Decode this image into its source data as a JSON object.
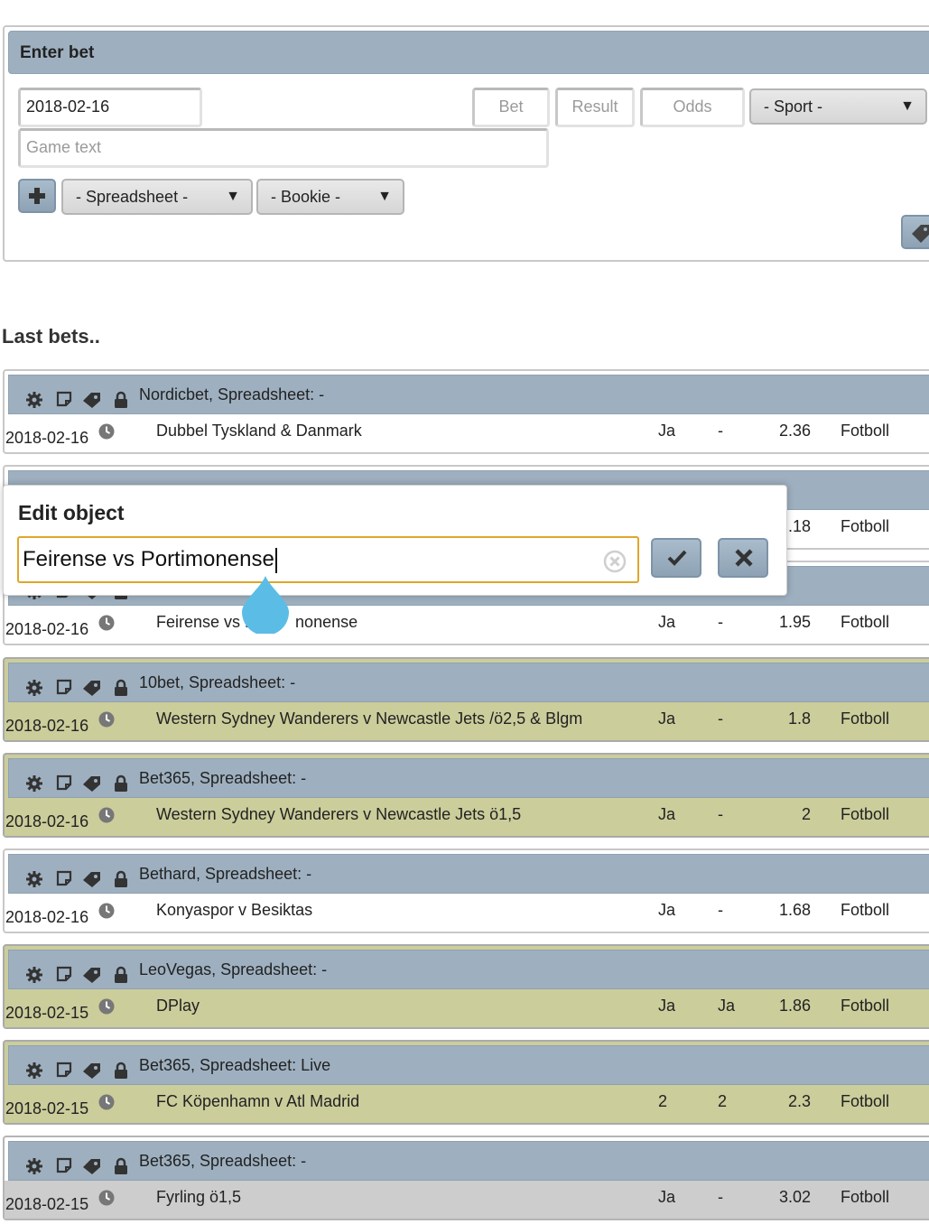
{
  "enter_bet": {
    "title": "Enter bet",
    "date_value": "2018-02-16",
    "bet_placeholder": "Bet",
    "result_placeholder": "Result",
    "odds_placeholder": "Odds",
    "sport_select": "- Sport -",
    "game_text_placeholder": "Game text",
    "add_icon": "plus-icon",
    "spreadsheet_select": "- Spreadsheet -",
    "bookie_select": "- Bookie -",
    "dropdown_arrow": "▼"
  },
  "last_bets_title": "Last bets..",
  "bets": [
    {
      "header": "Nordicbet, Spreadsheet: -",
      "date": "2018-02-16",
      "game": "Dubbel Tyskland & Danmark",
      "bet": "Ja",
      "result": "-",
      "odds": "2.36",
      "sport": "Fotboll",
      "style": "white"
    },
    {
      "header": "",
      "date": "",
      "game": "",
      "bet": "",
      "result": "",
      "odds": ".18",
      "sport": "Fotboll",
      "style": "white"
    },
    {
      "header": "",
      "date": "2018-02-16",
      "game": "Feirense vs P",
      "game_tail": "nonense",
      "bet": "Ja",
      "result": "-",
      "odds": "1.95",
      "sport": "Fotboll",
      "style": "white"
    },
    {
      "header": "10bet, Spreadsheet: -",
      "date": "2018-02-16",
      "game": "Western Sydney Wanderers v Newcastle Jets /ö2,5 & Blgm",
      "bet": "Ja",
      "result": "-",
      "odds": "1.8",
      "sport": "Fotboll",
      "style": "yellow"
    },
    {
      "header": "Bet365, Spreadsheet: -",
      "date": "2018-02-16",
      "game": "Western Sydney Wanderers v Newcastle Jets ö1,5",
      "bet": "Ja",
      "result": "-",
      "odds": "2",
      "sport": "Fotboll",
      "style": "yellow"
    },
    {
      "header": "Bethard, Spreadsheet: -",
      "date": "2018-02-16",
      "game": "Konyaspor v Besiktas",
      "bet": "Ja",
      "result": "-",
      "odds": "1.68",
      "sport": "Fotboll",
      "style": "white"
    },
    {
      "header": "LeoVegas, Spreadsheet: -",
      "date": "2018-02-15",
      "game": "DPlay",
      "bet": "Ja",
      "result": "Ja",
      "odds": "1.86",
      "sport": "Fotboll",
      "style": "yellow"
    },
    {
      "header": "Bet365, Spreadsheet: Live",
      "date": "2018-02-15",
      "game": "FC Köpenhamn v Atl Madrid",
      "bet": "2",
      "result": "2",
      "odds": "2.3",
      "sport": "Fotboll",
      "style": "yellow"
    },
    {
      "header": "Bet365, Spreadsheet: -",
      "date": "2018-02-15",
      "game": "Fyrling ö1,5",
      "bet": "Ja",
      "result": "-",
      "odds": "3.02",
      "sport": "Fotboll",
      "style": "grey"
    }
  ],
  "edit_dialog": {
    "title": "Edit object",
    "input_value": "Feirense vs Portimonense",
    "confirm_icon": "check-icon",
    "cancel_icon": "close-icon",
    "clear_icon": "clear-circle-icon"
  },
  "colors": {
    "header_bar": "#9eb0c0",
    "row_yellow": "#cbcd9b",
    "row_grey": "#cdcdcd",
    "focus_border": "#e0a62a",
    "drop_handle": "#5bbde6"
  }
}
